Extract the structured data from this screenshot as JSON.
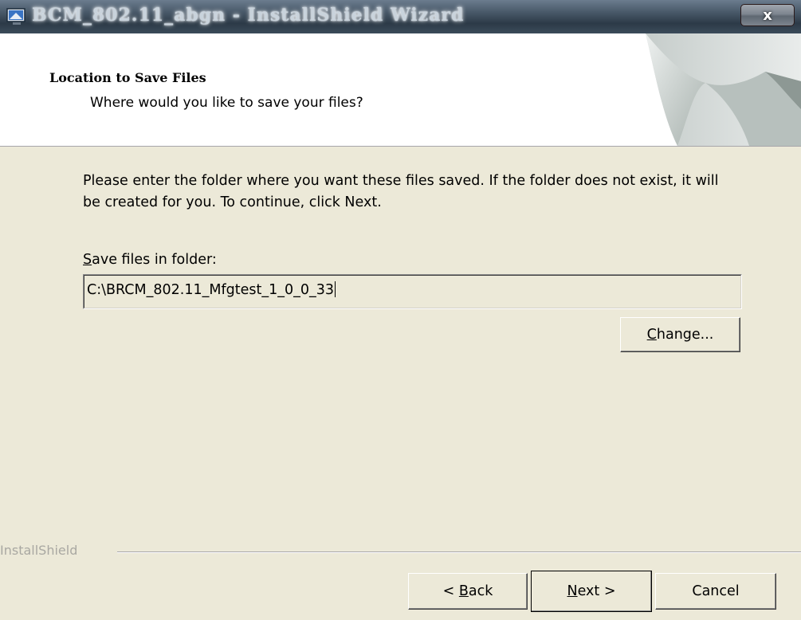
{
  "window": {
    "title": "BCM_802.11_abgn - InstallShield Wizard",
    "close_glyph": "x"
  },
  "header": {
    "title": "Location to Save Files",
    "subtitle": "Where would you like to save your files?"
  },
  "main": {
    "instructions": "Please enter the folder where you want these files saved.  If the folder does not exist, it will be created for you.   To continue, click Next.",
    "folder_label_accel": "S",
    "folder_label_rest": "ave files in folder:",
    "folder_value": "C:\\BRCM_802.11_Mfgtest_1_0_0_33"
  },
  "buttons": {
    "change_accel": "C",
    "change_rest": "hange...",
    "back_pre": "< ",
    "back_accel": "B",
    "back_rest": "ack",
    "next_accel": "N",
    "next_rest": "ext >",
    "cancel": "Cancel"
  },
  "footer": {
    "brand": "InstallShield"
  },
  "colors": {
    "dialog_bg": "#ece9d8",
    "header_bg": "#ffffff",
    "title_glow": "#ffffff"
  },
  "icons": {
    "app": "installer-monitor-icon",
    "close": "close-icon",
    "header_art": "page-curl-graphic"
  }
}
